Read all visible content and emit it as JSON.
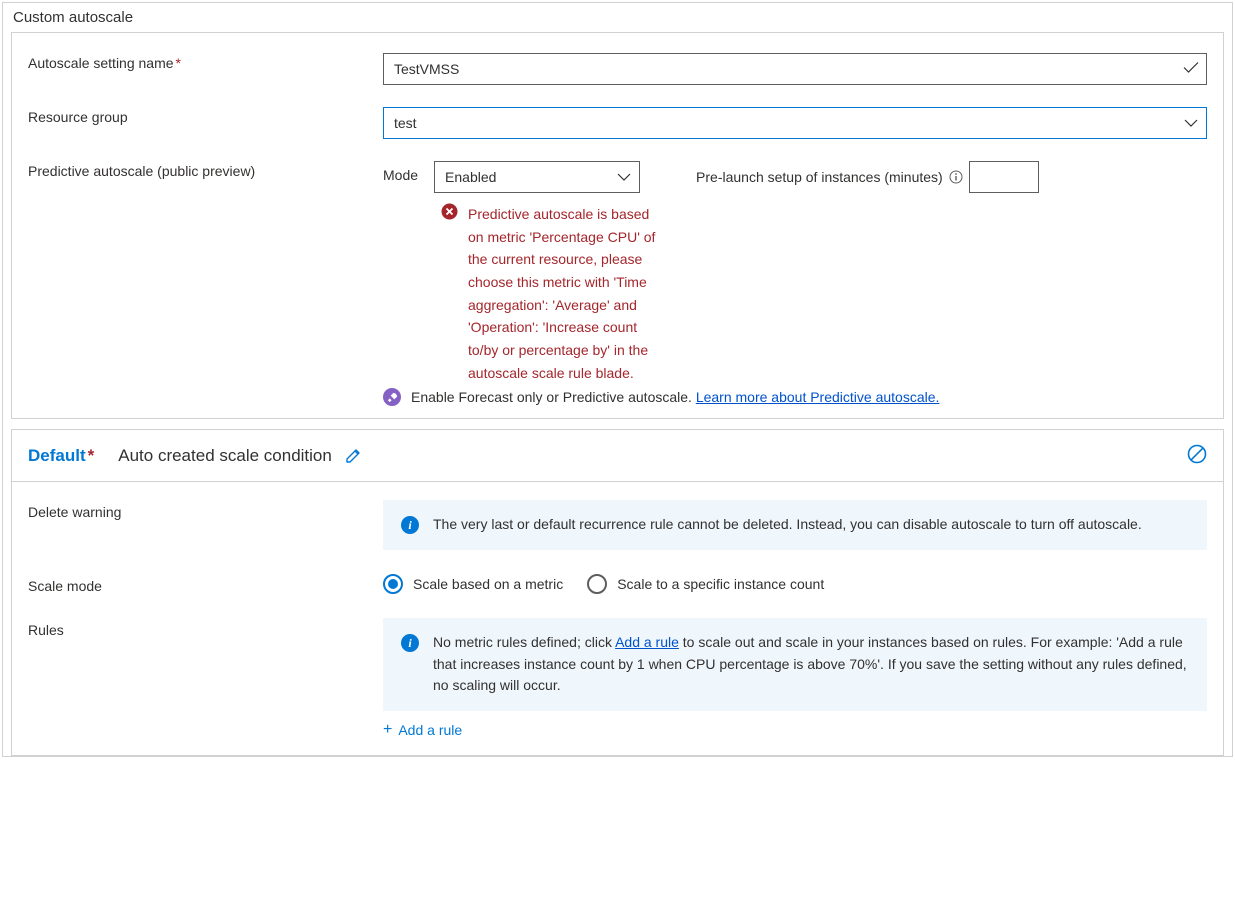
{
  "section_title": "Custom autoscale",
  "settings": {
    "name_label": "Autoscale setting name",
    "name_value": "TestVMSS",
    "rg_label": "Resource group",
    "rg_value": "test",
    "predictive_label": "Predictive autoscale (public preview)",
    "mode_label": "Mode",
    "mode_value": "Enabled",
    "prelaunch_label": "Pre-launch setup of instances (minutes)",
    "prelaunch_value": "",
    "error_text": "Predictive autoscale is based on metric 'Percentage CPU' of the current resource, please choose this metric with 'Time aggregation': 'Average' and 'Operation': 'Increase count to/by or percentage by' in the autoscale scale rule blade.",
    "helper_text_1": "Enable Forecast only or Predictive autoscale. ",
    "helper_link": "Learn more about Predictive autoscale."
  },
  "condition": {
    "default_label": "Default",
    "subtitle": "Auto created scale condition",
    "delete_warning_label": "Delete warning",
    "delete_warning_text": "The very last or default recurrence rule cannot be deleted. Instead, you can disable autoscale to turn off autoscale.",
    "scale_mode_label": "Scale mode",
    "radio_metric": "Scale based on a metric",
    "radio_count": "Scale to a specific instance count",
    "rules_label": "Rules",
    "rules_info_1": "No metric rules defined; click ",
    "rules_info_link": "Add a rule",
    "rules_info_2": " to scale out and scale in your instances based on rules. For example: 'Add a rule that increases instance count by 1 when CPU percentage is above 70%'. If you save the setting without any rules defined, no scaling will occur.",
    "add_rule_label": "Add a rule"
  }
}
